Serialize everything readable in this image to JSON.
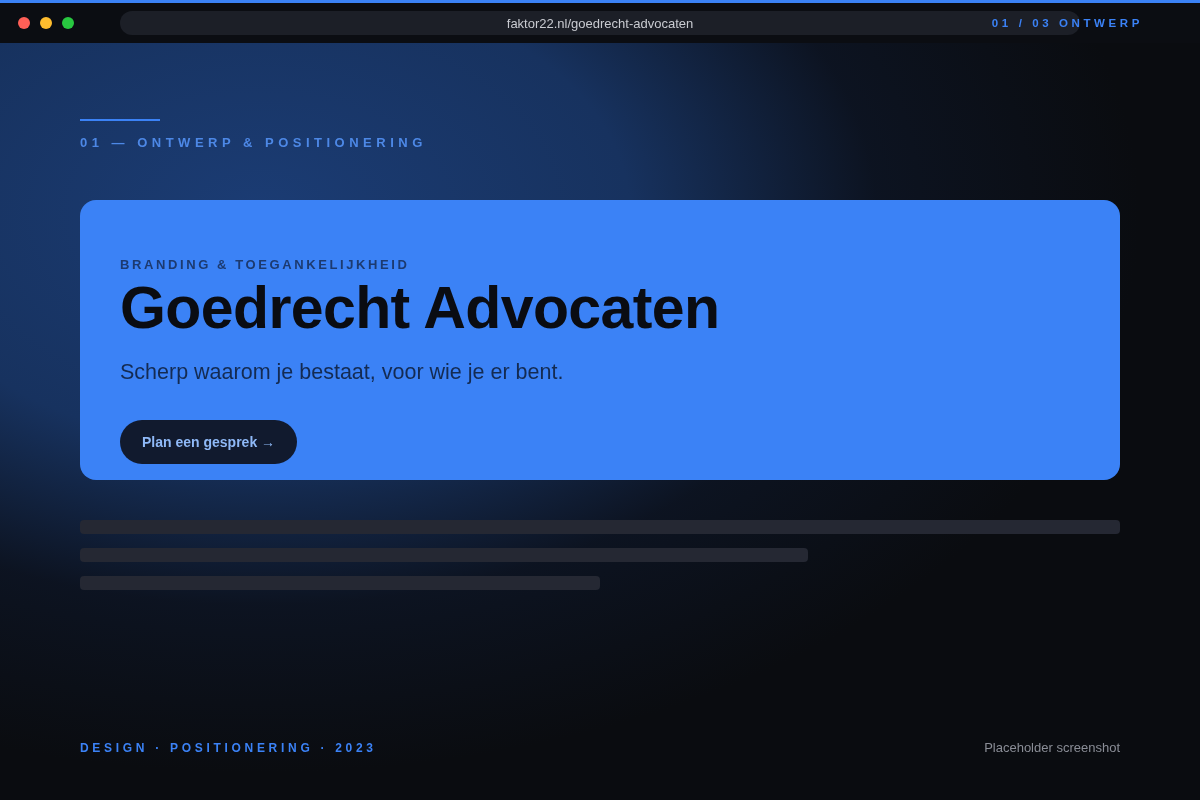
{
  "browser": {
    "url": "faktor22.nl/goedrecht-advocaten",
    "counter": "01 / 03 ONTWERP"
  },
  "section": {
    "label": "01 — ONTWERP & POSITIONERING"
  },
  "hero_card": {
    "kicker": "BRANDING & TOEGANKELIJKHEID",
    "title": "Goedrecht Advocaten",
    "subtitle": "Scherp waarom je bestaat, voor wie je er bent.",
    "button": "Plan een gesprek →"
  },
  "footer": {
    "tags": "DESIGN · POSITIONERING · 2023",
    "note": "Placeholder screenshot"
  }
}
